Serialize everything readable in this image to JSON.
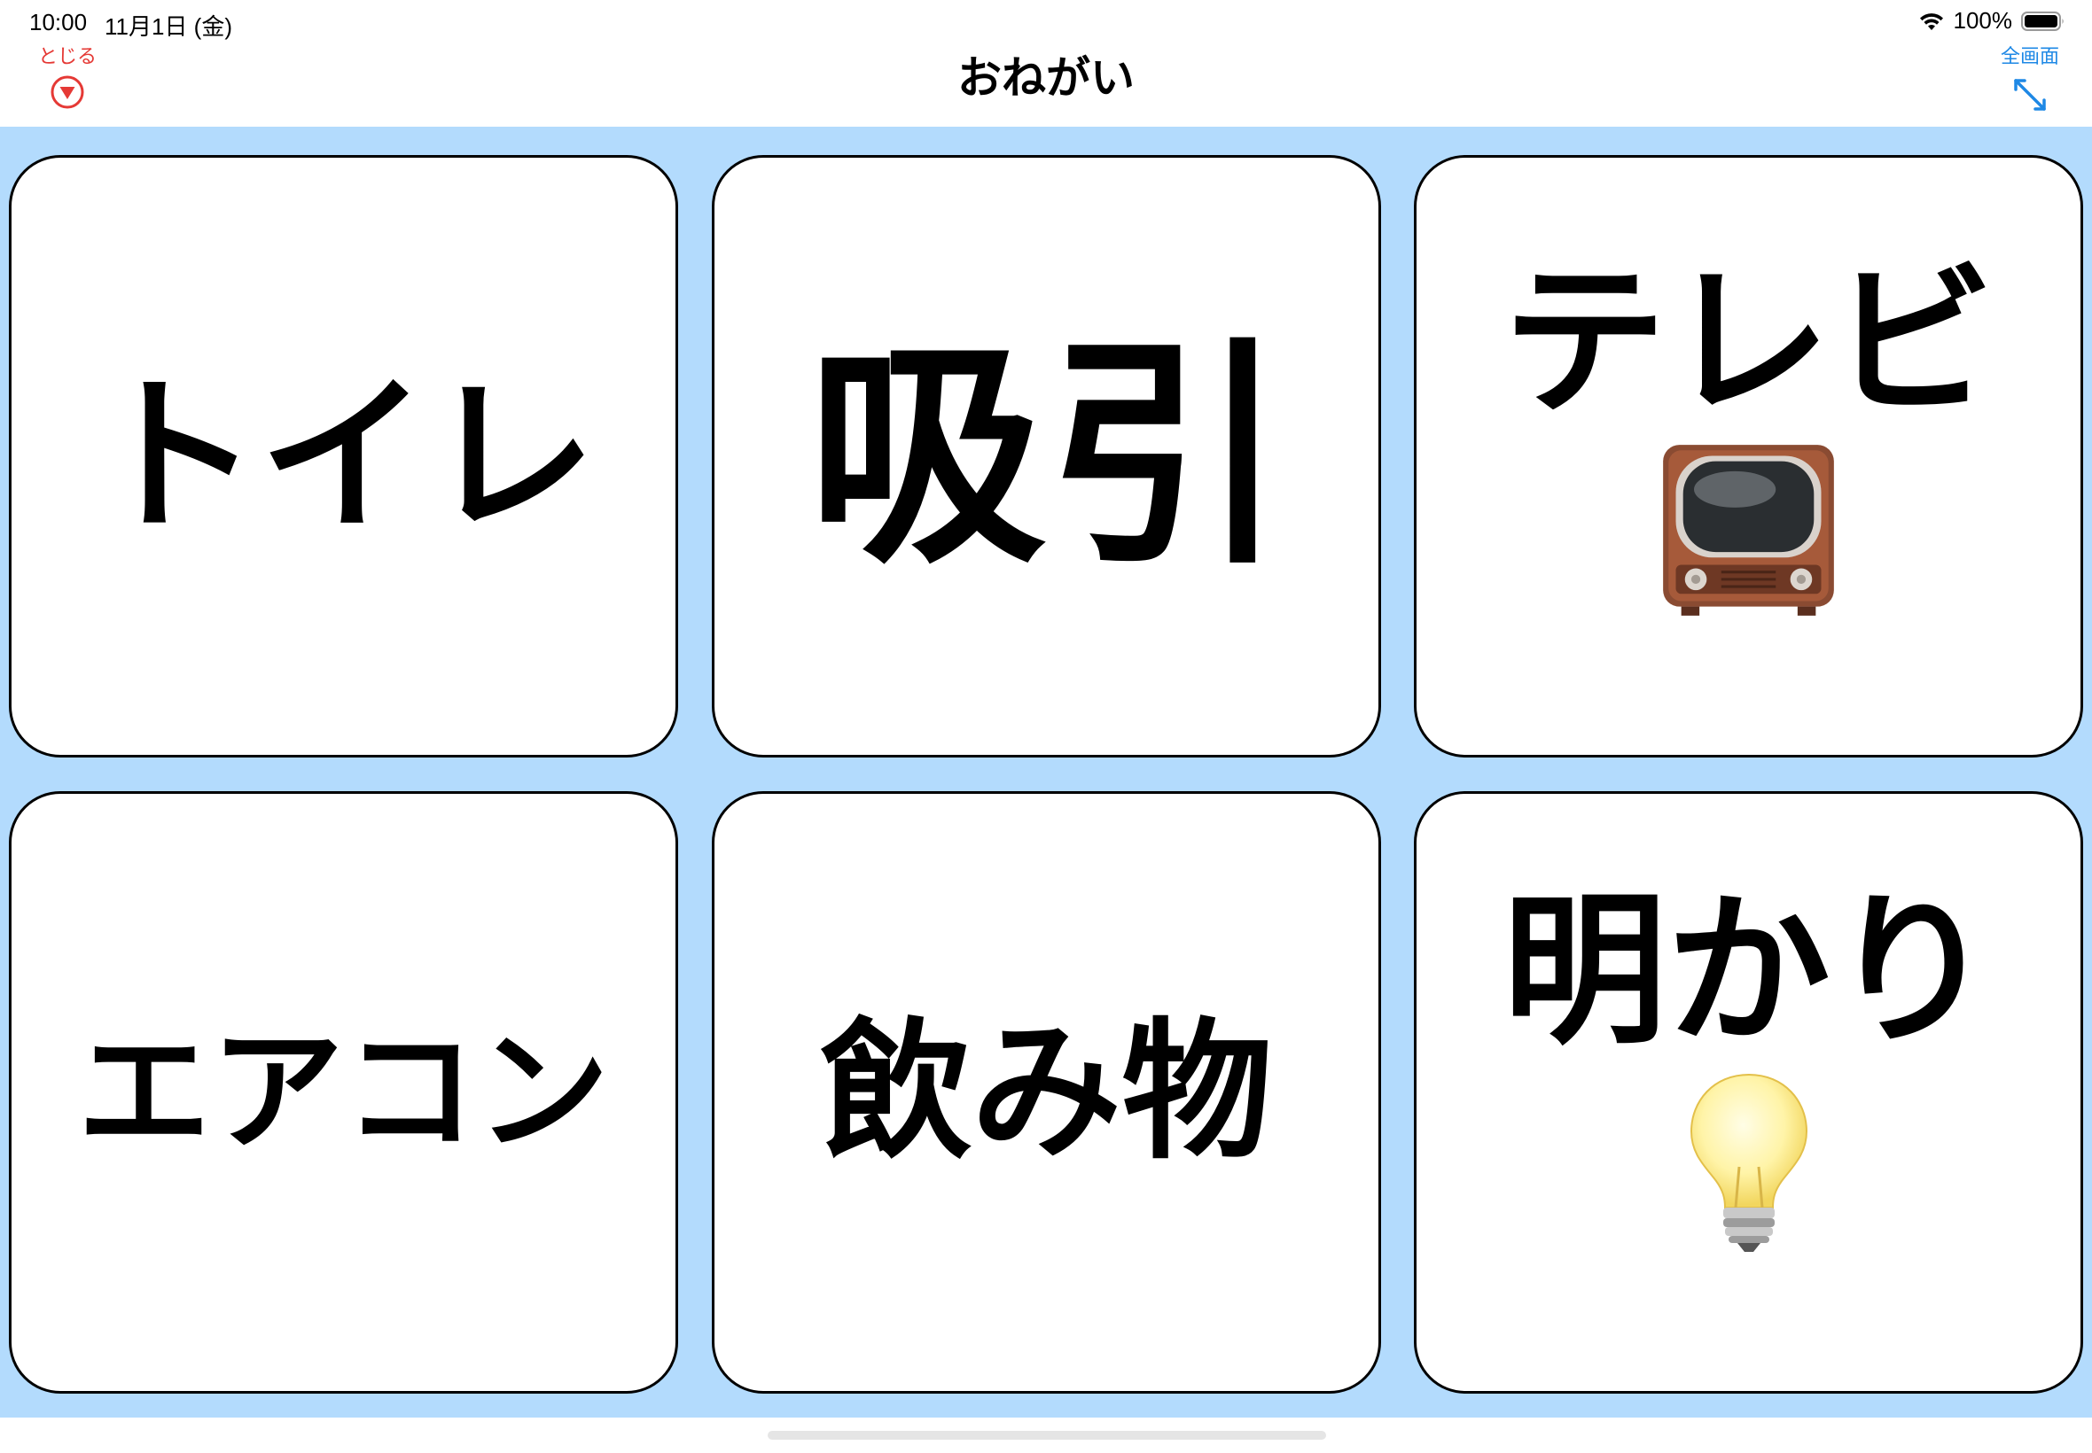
{
  "status_bar": {
    "time": "10:00",
    "date": "11月1日 (金)",
    "battery_percent": "100%",
    "battery_level": 1.0
  },
  "nav": {
    "close_label": "とじる",
    "title": "おねがい",
    "fullscreen_label": "全画面"
  },
  "board": {
    "cards": [
      {
        "label": "トイレ",
        "icon": ""
      },
      {
        "label": "吸引",
        "icon": ""
      },
      {
        "label": "テレビ",
        "icon": "television-icon"
      },
      {
        "label": "エアコン",
        "icon": ""
      },
      {
        "label": "飲み物",
        "icon": ""
      },
      {
        "label": "明かり",
        "icon": "light-bulb-icon"
      }
    ]
  },
  "colors": {
    "board_background": "#b3dbfd",
    "close_accent": "#e53935",
    "fullscreen_accent": "#1e88e5",
    "card_border": "#000000"
  }
}
